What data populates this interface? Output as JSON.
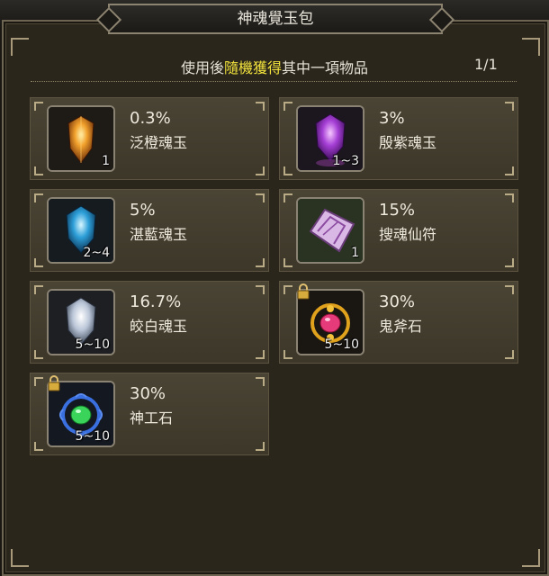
{
  "window": {
    "title": "神魂覺玉包"
  },
  "header": {
    "prefix": "使用後",
    "highlight": "隨機獲得",
    "suffix": "其中一項物品",
    "page": "1/1"
  },
  "items": [
    {
      "name": "泛橙魂玉",
      "rate": "0.3%",
      "qty": "1",
      "locked": false,
      "icon": "orange-soul-gem-icon"
    },
    {
      "name": "殷紫魂玉",
      "rate": "3%",
      "qty": "1~3",
      "locked": false,
      "icon": "purple-soul-gem-icon"
    },
    {
      "name": "湛藍魂玉",
      "rate": "5%",
      "qty": "2~4",
      "locked": false,
      "icon": "blue-soul-gem-icon"
    },
    {
      "name": "搜魂仙符",
      "rate": "15%",
      "qty": "1",
      "locked": false,
      "icon": "soul-talisman-scroll-icon"
    },
    {
      "name": "皎白魂玉",
      "rate": "16.7%",
      "qty": "5~10",
      "locked": false,
      "icon": "white-soul-gem-icon"
    },
    {
      "name": "鬼斧石",
      "rate": "30%",
      "qty": "5~10",
      "locked": true,
      "icon": "ghost-axe-stone-icon"
    },
    {
      "name": "神工石",
      "rate": "30%",
      "qty": "5~10",
      "locked": true,
      "icon": "divine-craft-stone-icon"
    }
  ]
}
